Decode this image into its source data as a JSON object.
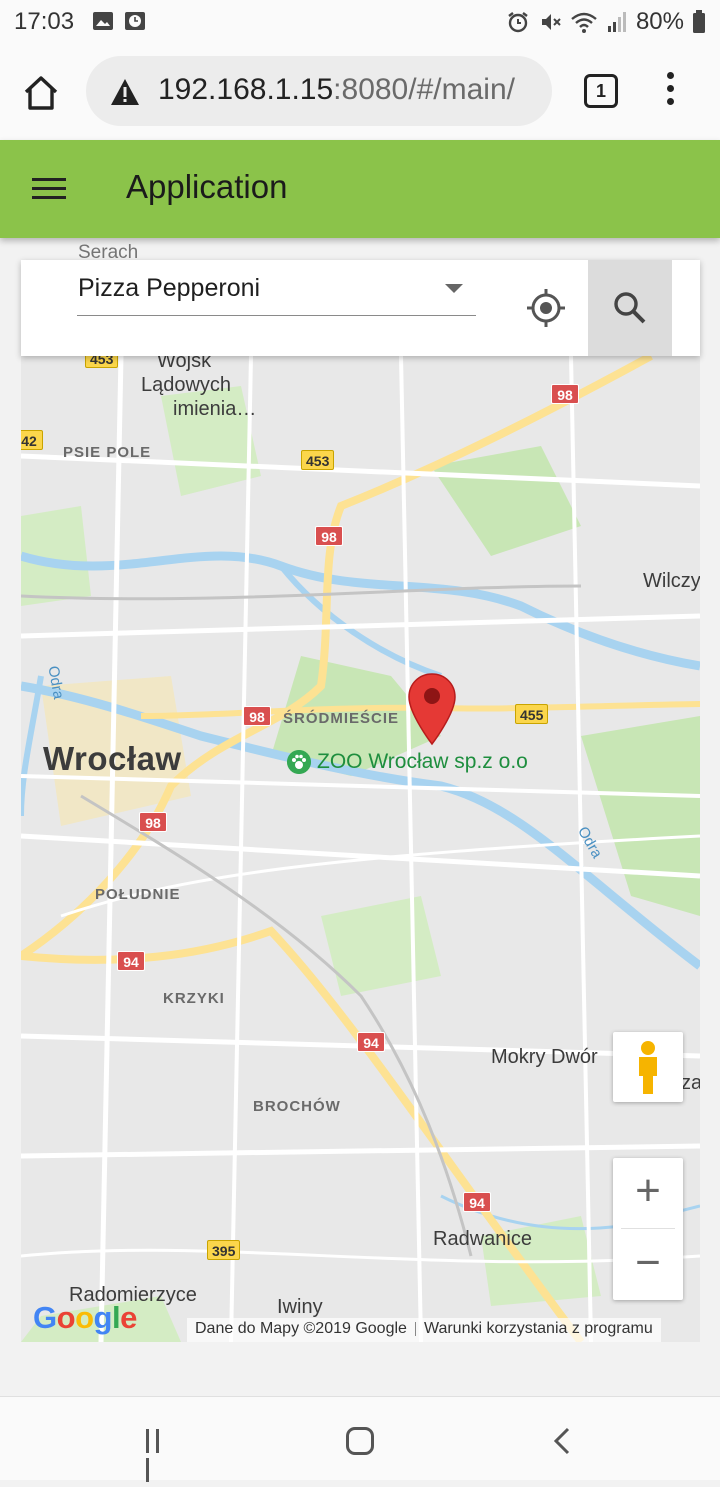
{
  "status_bar": {
    "time": "17:03",
    "battery": "80%",
    "icons": [
      "image-icon",
      "clock-app-icon",
      "alarm-icon",
      "mute-icon",
      "wifi-icon",
      "signal-icon",
      "battery-icon"
    ]
  },
  "browser": {
    "url_host": "192.168.1.15",
    "url_rest": ":8080/#/main/",
    "tab_count": "1"
  },
  "app_bar": {
    "title": "Application"
  },
  "search": {
    "label": "Serach",
    "selected_value": "Pizza Pepperoni"
  },
  "map": {
    "labels": {
      "city": "Wrocław",
      "wojsk": "Wojsk",
      "ladowych": "Lądowych",
      "imienia": "imienia…",
      "psie_pole": "PSIE POLE",
      "srodmiescie": "ŚRÓDMIEŚCIE",
      "poludnie": "POŁUDNIE",
      "krzyki": "KRZYKI",
      "brochow": "BROCHÓW",
      "wilczy": "Wilczy",
      "mokry_dwor": "Mokry Dwór",
      "radwanice": "Radwanice",
      "radomierzyce": "Radomierzyce",
      "iwiny": "Iwiny",
      "odra_west": "Odra",
      "odra_east": "Odra",
      "zbyt": "za"
    },
    "place_name": "ZOO Wrocław sp.z o.o",
    "roads": {
      "r453_top": "453",
      "r42": "42",
      "r453": "453",
      "r98_ne": "98",
      "r98_north": "98",
      "r98_center": "98",
      "r98_west": "98",
      "r455": "455",
      "r94_west": "94",
      "r94_mid": "94",
      "r94_south": "94",
      "r395": "395"
    },
    "zoom_in": "+",
    "zoom_out": "−",
    "google": "Google",
    "attribution_data": "Dane do Mapy ©2019 Google",
    "attribution_terms": "Warunki korzystania z programu",
    "colors": {
      "water": "#a8d3f0",
      "park": "#c8e6b5",
      "road_major": "#fde293",
      "road_minor": "#ffffff",
      "marker": "#e53935"
    }
  },
  "colors": {
    "app_bar": "#8bc34a",
    "search_button_bg": "#dcdcdc"
  }
}
